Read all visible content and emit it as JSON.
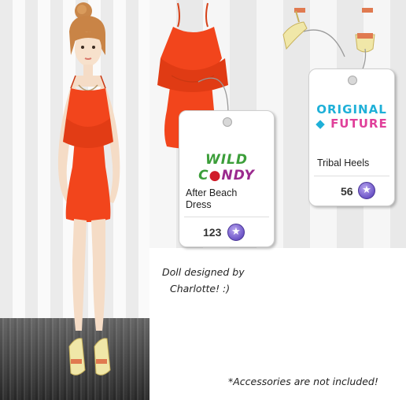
{
  "dress_tag": {
    "brand_part1": "WILD C",
    "brand_part2": "NDY",
    "name_line1": "After Beach",
    "name_line2": "Dress",
    "price": "123",
    "currency_icon": "star-coin-icon"
  },
  "heels_tag": {
    "brand_line1": "ORIGINAL",
    "brand_line2": "FUTURE",
    "name": "Tribal Heels",
    "price": "56",
    "currency_icon": "star-coin-icon"
  },
  "credit": {
    "line1": "Doll designed by",
    "line2": "Charlotte! :)"
  },
  "footnote": "*Accessories are not included!",
  "colors": {
    "dress": "#f2451c",
    "coin": "#6d55c7",
    "wild_candy_accent": "#9b2a8e",
    "original_future_blue": "#1fb0d8"
  }
}
